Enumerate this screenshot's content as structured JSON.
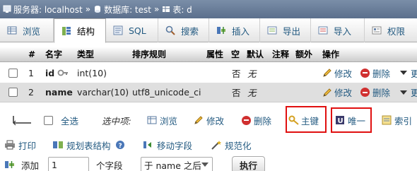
{
  "breadcrumb": {
    "server": "服务器: localhost",
    "database": "数据库: test",
    "table": "表: d",
    "separator": "»"
  },
  "tabs": [
    {
      "label": "浏览",
      "icon": "browse-icon",
      "active": false
    },
    {
      "label": "结构",
      "icon": "structure-icon",
      "active": true
    },
    {
      "label": "SQL",
      "icon": "sql-icon",
      "active": false
    },
    {
      "label": "搜索",
      "icon": "search-icon",
      "active": false
    },
    {
      "label": "插入",
      "icon": "insert-icon",
      "active": false
    },
    {
      "label": "导出",
      "icon": "export-icon",
      "active": false
    },
    {
      "label": "导入",
      "icon": "import-icon",
      "active": false
    },
    {
      "label": "权限",
      "icon": "privileges-icon",
      "active": false
    }
  ],
  "table": {
    "headers": [
      "#",
      "名字",
      "类型",
      "排序规则",
      "属性",
      "空",
      "默认",
      "注释",
      "额外",
      "操作"
    ],
    "rows": [
      {
        "num": "1",
        "name": "id",
        "type": "int(10)",
        "collation": "",
        "attributes": "",
        "null": "否",
        "default": "无",
        "comment": "",
        "extra": "",
        "edit": "修改",
        "delete": "删除",
        "more": "更"
      },
      {
        "num": "2",
        "name": "name",
        "type": "varchar(10)",
        "collation": "utf8_unicode_ci",
        "attributes": "",
        "null": "否",
        "default": "无",
        "comment": "",
        "extra": "",
        "edit": "修改",
        "delete": "删除",
        "more": "更"
      }
    ]
  },
  "selection": {
    "select_all": "全选",
    "with_selected": "选中项:",
    "browse": "浏览",
    "edit": "修改",
    "delete": "删除",
    "primary": "主键",
    "unique": "唯一",
    "index": "索引"
  },
  "actions": {
    "print": "打印",
    "relation_view": "规划表结构",
    "move_columns": "移动字段",
    "normalize": "规范化"
  },
  "add_column": {
    "add_label": "添加",
    "count_value": "1",
    "fields_label": "个字段",
    "position_selected": "于 name 之后",
    "go_button": "执行"
  },
  "colors": {
    "link": "#235a81",
    "highlight": "#e01010",
    "breadcrumb_bg": "#6b7f9b"
  }
}
